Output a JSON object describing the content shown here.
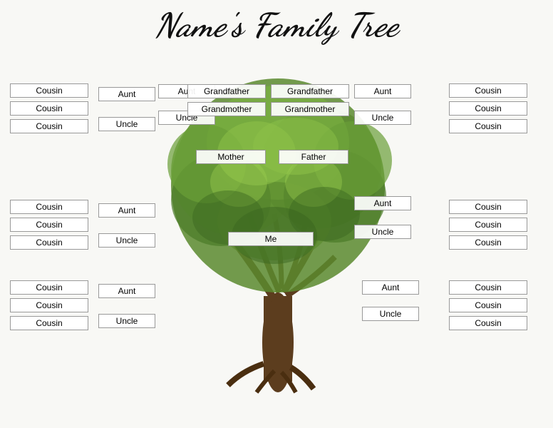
{
  "title": "Name's Family Tree",
  "labels": {
    "lc1": "Cousin",
    "lc2": "Cousin",
    "lc3": "Cousin",
    "la1": "Aunt",
    "lu1": "Uncle",
    "lc4": "Cousin",
    "lc5": "Cousin",
    "lc6": "Cousin",
    "la2": "Aunt",
    "lu2": "Uncle",
    "lc7": "Cousin",
    "lc8": "Cousin",
    "lc9": "Cousin",
    "la3": "Aunt",
    "lu3": "Uncle",
    "cgf1": "Grandfather",
    "cgf2": "Grandfather",
    "cgm1": "Grandmother",
    "cgm2": "Grandmother",
    "cau1": "Aunt",
    "cau2": "Uncle",
    "cau3": "Aunt",
    "cau4": "Uncle",
    "cm": "Mother",
    "cf": "Father",
    "cau5": "Aunt",
    "cau6": "Uncle",
    "cme": "Me",
    "rc1": "Cousin",
    "rc2": "Cousin",
    "rc3": "Cousin",
    "rc4": "Cousin",
    "rc5": "Cousin",
    "rc6": "Cousin",
    "rc7": "Cousin",
    "rc8": "Cousin",
    "rc9": "Cousin",
    "ra3": "Aunt",
    "ru4": "Uncle"
  }
}
